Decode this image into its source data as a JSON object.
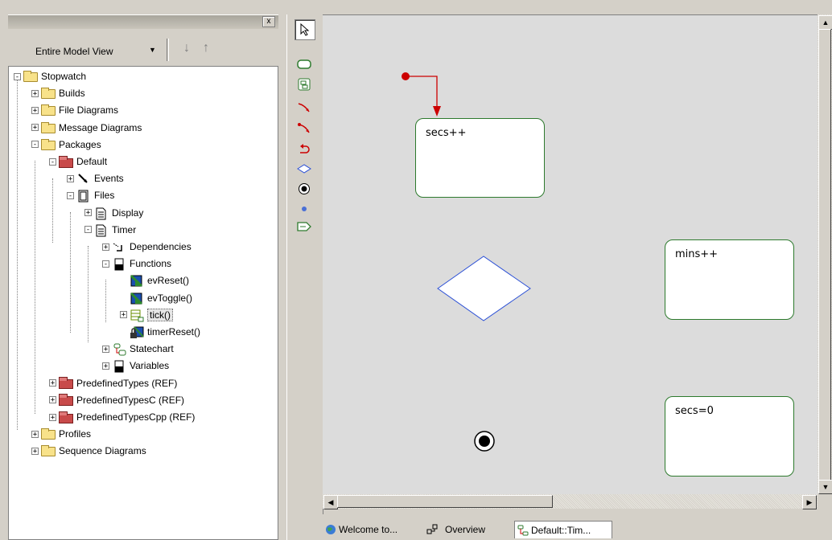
{
  "browser": {
    "close_label": "x",
    "view_label": "Entire Model View",
    "tree": [
      {
        "label": "Stopwatch",
        "depth": 0,
        "pm": "-",
        "icon": "folder"
      },
      {
        "label": "Builds",
        "depth": 1,
        "pm": "+",
        "icon": "folder"
      },
      {
        "label": "File Diagrams",
        "depth": 1,
        "pm": "+",
        "icon": "folder"
      },
      {
        "label": "Message Diagrams",
        "depth": 1,
        "pm": "+",
        "icon": "folder"
      },
      {
        "label": "Packages",
        "depth": 1,
        "pm": "-",
        "icon": "folder"
      },
      {
        "label": "Default",
        "depth": 2,
        "pm": "-",
        "icon": "package"
      },
      {
        "label": "Events",
        "depth": 3,
        "pm": "+",
        "icon": "event"
      },
      {
        "label": "Files",
        "depth": 3,
        "pm": "-",
        "icon": "files"
      },
      {
        "label": "Display",
        "depth": 4,
        "pm": "+",
        "icon": "file"
      },
      {
        "label": "Timer",
        "depth": 4,
        "pm": "-",
        "icon": "file"
      },
      {
        "label": "Dependencies",
        "depth": 5,
        "pm": "+",
        "icon": "dependency"
      },
      {
        "label": "Functions",
        "depth": 5,
        "pm": "-",
        "icon": "functions"
      },
      {
        "label": "evReset()",
        "depth": 6,
        "pm": "",
        "icon": "function"
      },
      {
        "label": "evToggle()",
        "depth": 6,
        "pm": "",
        "icon": "function"
      },
      {
        "label": "tick()",
        "depth": 6,
        "pm": "+",
        "icon": "function-state",
        "selected": true
      },
      {
        "label": "timerReset()",
        "depth": 6,
        "pm": "",
        "icon": "function-lock"
      },
      {
        "label": "Statechart",
        "depth": 5,
        "pm": "+",
        "icon": "statechart"
      },
      {
        "label": "Variables",
        "depth": 5,
        "pm": "+",
        "icon": "functions"
      },
      {
        "label": "PredefinedTypes (REF)",
        "depth": 2,
        "pm": "+",
        "icon": "package"
      },
      {
        "label": "PredefinedTypesC (REF)",
        "depth": 2,
        "pm": "+",
        "icon": "package"
      },
      {
        "label": "PredefinedTypesCpp (REF)",
        "depth": 2,
        "pm": "+",
        "icon": "package"
      },
      {
        "label": "Profiles",
        "depth": 1,
        "pm": "+",
        "icon": "folder"
      },
      {
        "label": "Sequence Diagrams",
        "depth": 1,
        "pm": "+",
        "icon": "folder"
      }
    ]
  },
  "toolbar": {
    "tools": [
      "select-arrow-icon",
      "state-icon",
      "composite-state-icon",
      "transition-icon",
      "transition-arrow-icon",
      "self-transition-icon",
      "condition-icon",
      "termination-icon",
      "junction-icon",
      "send-action-icon"
    ]
  },
  "canvas": {
    "states": [
      {
        "label": "secs++"
      },
      {
        "label": "mins++"
      },
      {
        "label": "secs=0"
      }
    ],
    "accent_transition": "#cc0000",
    "state_border": "#2d7a2d",
    "condition_border": "#2a4fd6"
  },
  "tabs": [
    {
      "label": "Welcome to...",
      "icon": "globe-icon"
    },
    {
      "label": "Overview",
      "icon": "overview-icon"
    },
    {
      "label": "Default::Tim...",
      "icon": "statechart-icon"
    }
  ]
}
